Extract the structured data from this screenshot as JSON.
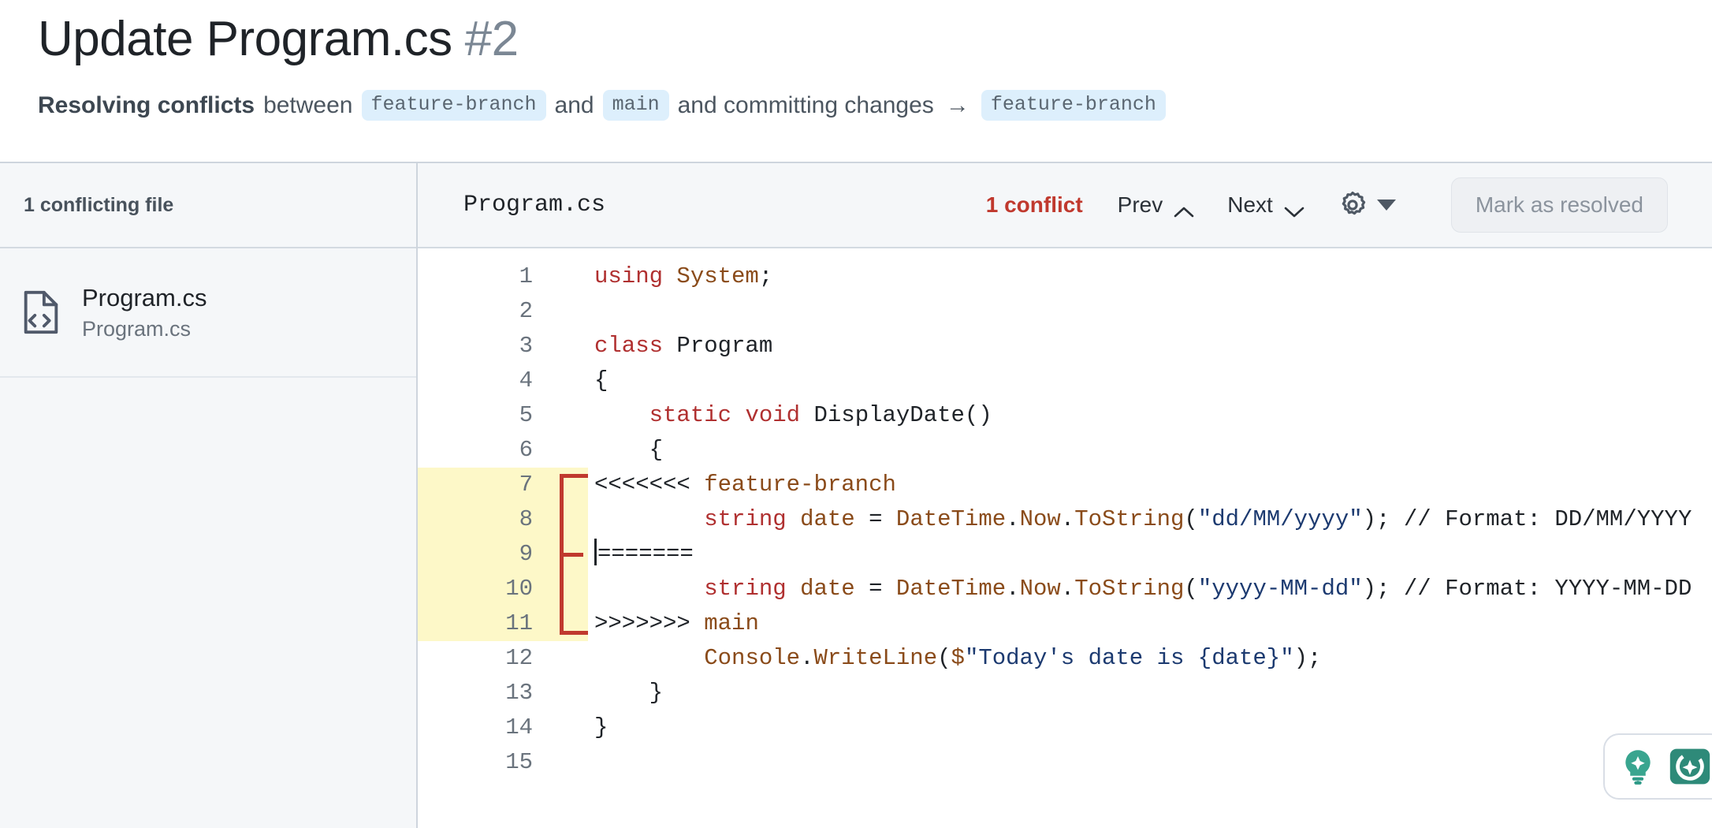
{
  "header": {
    "title": "Update Program.cs",
    "number": "#2",
    "subtitle": {
      "strong": "Resolving conflicts",
      "between": "between",
      "source_branch": "feature-branch",
      "and1": "and",
      "target_branch": "main",
      "tail": "and committing changes",
      "arrow": "→",
      "commit_branch": "feature-branch"
    }
  },
  "sidebar": {
    "heading": "1 conflicting file",
    "files": [
      {
        "name": "Program.cs",
        "path": "Program.cs",
        "icon": "file-code-icon"
      }
    ]
  },
  "toolbar": {
    "filename": "Program.cs",
    "conflict_count": "1 conflict",
    "prev_label": "Prev",
    "next_label": "Next",
    "prev_icon": "chevron-up-icon",
    "next_icon": "chevron-down-icon",
    "settings_icon": "gear-icon",
    "settings_caret": "caret-down-icon",
    "resolve_label": "Mark as resolved"
  },
  "colors": {
    "conflict_red": "#c0392e",
    "branch_chip_bg": "#ddeffc",
    "conflict_highlight": "#fdf8c8",
    "panel_bg": "#f5f7f9",
    "accent_teal": "#2e9a87"
  },
  "editor": {
    "lines": [
      {
        "n": "1",
        "conflict": false,
        "text": "using System;"
      },
      {
        "n": "2",
        "conflict": false,
        "text": ""
      },
      {
        "n": "3",
        "conflict": false,
        "text": "class Program"
      },
      {
        "n": "4",
        "conflict": false,
        "text": "{"
      },
      {
        "n": "5",
        "conflict": false,
        "text": "    static void DisplayDate()"
      },
      {
        "n": "6",
        "conflict": false,
        "text": "    {"
      },
      {
        "n": "7",
        "conflict": true,
        "text": "<<<<<<< feature-branch"
      },
      {
        "n": "8",
        "conflict": true,
        "text": "        string date = DateTime.Now.ToString(\"dd/MM/yyyy\"); // Format: DD/MM/YYYY"
      },
      {
        "n": "9",
        "conflict": true,
        "text": "======="
      },
      {
        "n": "10",
        "conflict": true,
        "text": "        string date = DateTime.Now.ToString(\"yyyy-MM-dd\"); // Format: YYYY-MM-DD"
      },
      {
        "n": "11",
        "conflict": true,
        "text": ">>>>>>> main"
      },
      {
        "n": "12",
        "conflict": false,
        "text": "        Console.WriteLine($\"Today's date is {date}\");"
      },
      {
        "n": "13",
        "conflict": false,
        "text": "    }"
      },
      {
        "n": "14",
        "conflict": false,
        "text": "}"
      },
      {
        "n": "15",
        "conflict": false,
        "text": ""
      }
    ]
  },
  "floating": {
    "bulb_icon": "lightbulb-sparkle-icon",
    "assistant_icon": "assistant-circle-icon"
  }
}
